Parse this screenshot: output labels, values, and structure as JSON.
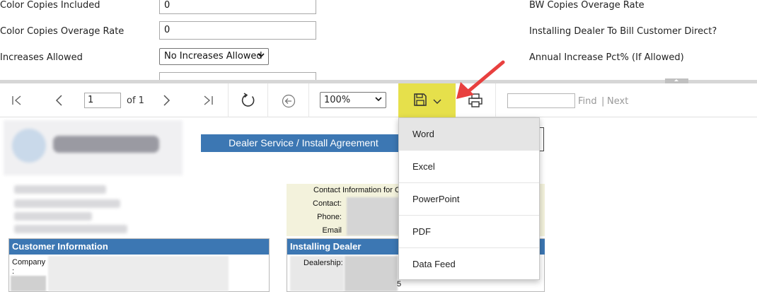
{
  "form": {
    "left_fields": [
      {
        "label": "Color Copies Included",
        "value": "0"
      },
      {
        "label": "Color Copies Overage Rate",
        "value": "0"
      },
      {
        "label": "Increases Allowed",
        "value": "No Increases Allowed"
      }
    ],
    "right_labels": [
      "BW Copies Overage Rate",
      "Installing Dealer To Bill Customer Direct?",
      "Annual Increase Pct% (If Allowed)"
    ]
  },
  "toolbar": {
    "page_current": "1",
    "page_of": "of 1",
    "zoom": "100%",
    "find_label": "Find",
    "separator": "|",
    "next_label": "Next",
    "highlight_color": "#e6e04b"
  },
  "export_menu": {
    "items": [
      "Word",
      "Excel",
      "PowerPoint",
      "PDF",
      "Data Feed"
    ],
    "hovered": "Word"
  },
  "report": {
    "title": "Dealer Service / Install Agreement",
    "contact": {
      "heading": "Contact Information for C",
      "contact_label": "Contact:",
      "phone_label": "Phone:",
      "email_label": "Email"
    },
    "customer_section": {
      "title": "Customer Information",
      "company_label": "Company",
      "colon": ":"
    },
    "dealer_section": {
      "title": "Installing Dealer Informati",
      "dealership_label": "Dealership:",
      "partial_text": "5"
    },
    "header_color": "#3c77b3"
  },
  "annotation": {
    "arrow_color": "#e8403f"
  }
}
